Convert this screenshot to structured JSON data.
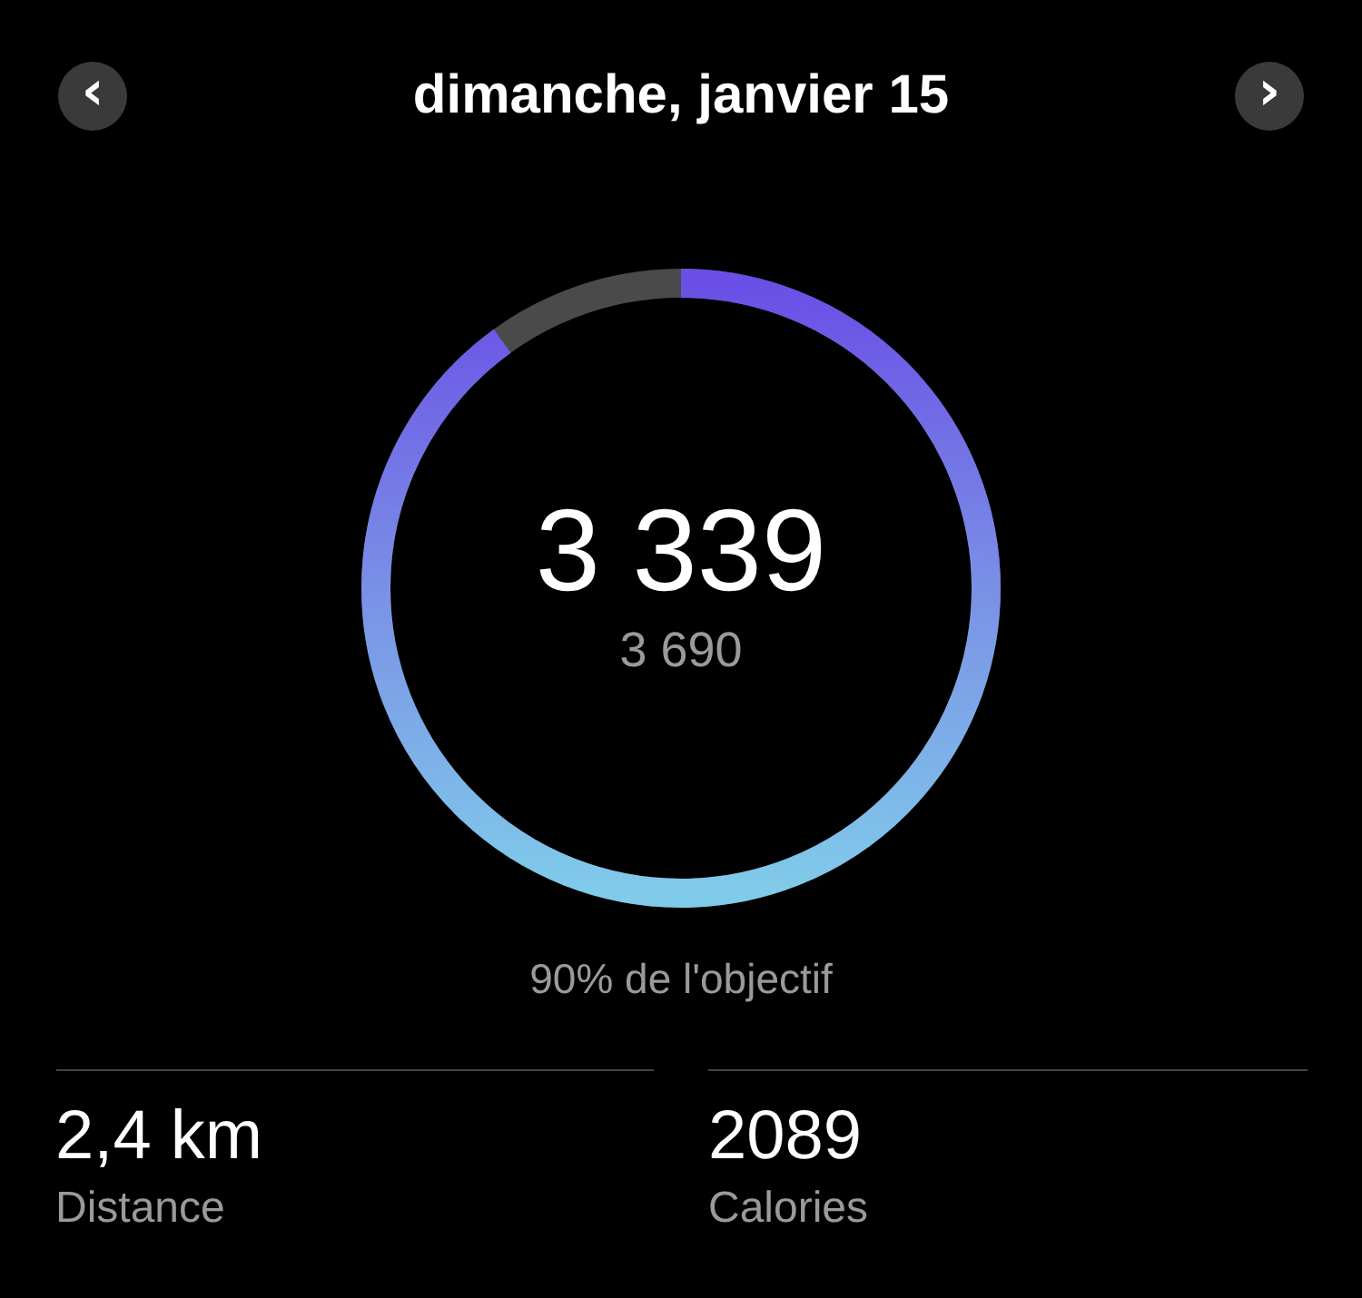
{
  "header": {
    "title": "dimanche, janvier 15",
    "prev_label": "‹",
    "next_label": "›"
  },
  "steps": {
    "count": "3 339",
    "goal": "3 690",
    "caption": "90% de l'objectif"
  },
  "stats": [
    {
      "value": "2,4 km",
      "label": "Distance"
    },
    {
      "value": "2089",
      "label": "Calories"
    }
  ]
}
